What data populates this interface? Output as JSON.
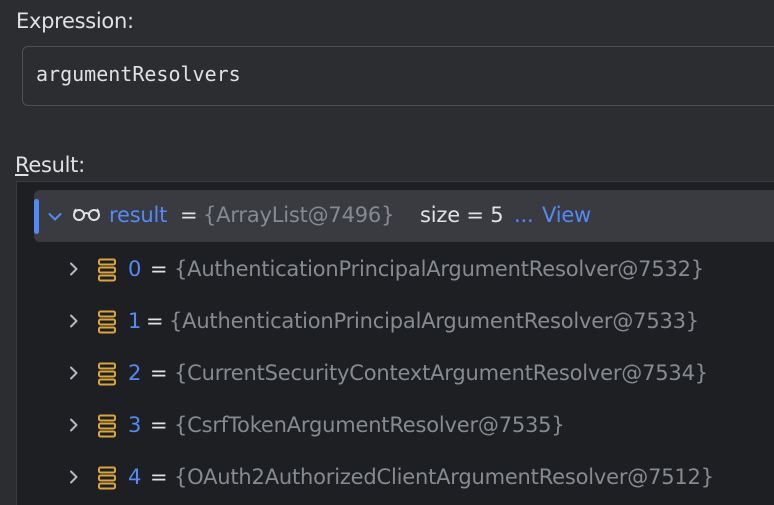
{
  "expression": {
    "label": "Expression:",
    "value": "argumentResolvers"
  },
  "result": {
    "label_mnemonic": "R",
    "label_rest": "esult:",
    "root": {
      "name": "result",
      "eq": "=",
      "type": "{ArrayList@7496}",
      "size_text": "size = 5",
      "ellipsis": "...",
      "view_label": "View"
    },
    "children": [
      {
        "index": "0",
        "eq": "=",
        "value": "{AuthenticationPrincipalArgumentResolver@7532}"
      },
      {
        "index": "1",
        "eq": "=",
        "value": "{AuthenticationPrincipalArgumentResolver@7533}"
      },
      {
        "index": "2",
        "eq": "=",
        "value": "{CurrentSecurityContextArgumentResolver@7534}"
      },
      {
        "index": "3",
        "eq": "=",
        "value": "{CsrfTokenArgumentResolver@7535}"
      },
      {
        "index": "4",
        "eq": "=",
        "value": "{OAuth2AuthorizedClientArgumentResolver@7512}"
      }
    ]
  },
  "colors": {
    "accent": "#548af7",
    "icon_orange": "#d8a63a",
    "muted": "#868a91",
    "background": "#2b2d30",
    "panel": "#1e1f22",
    "selection": "#393b40"
  },
  "icons": {
    "root_expand": "chevron-down-icon",
    "watch": "glasses-icon",
    "child_expand": "chevron-right-icon",
    "element": "array-element-icon"
  }
}
